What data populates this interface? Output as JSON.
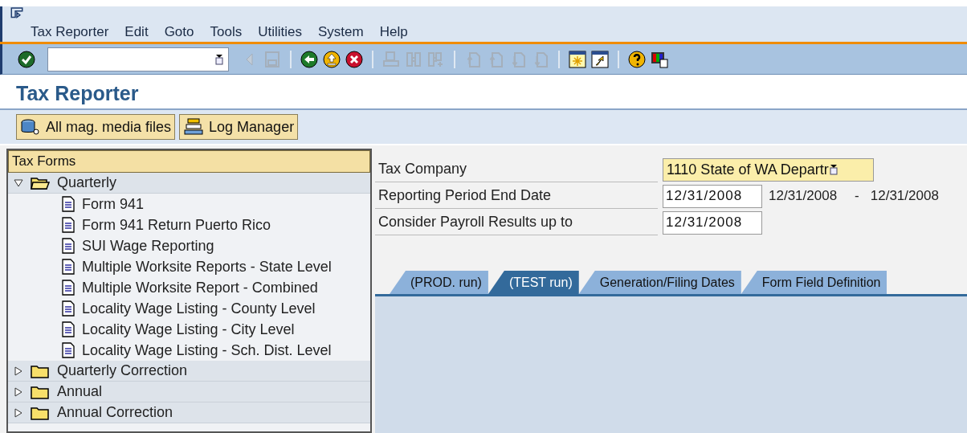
{
  "menu": [
    "Tax Reporter",
    "Edit",
    "Goto",
    "Tools",
    "Utilities",
    "System",
    "Help"
  ],
  "toolbar": [
    {
      "kind": "enter",
      "disabled": false
    },
    {
      "kind": "command-field"
    },
    {
      "kind": "back-arrow",
      "disabled": true
    },
    {
      "kind": "save",
      "disabled": true
    },
    {
      "kind": "separator"
    },
    {
      "kind": "back",
      "disabled": false
    },
    {
      "kind": "exit",
      "disabled": false
    },
    {
      "kind": "cancel",
      "disabled": false
    },
    {
      "kind": "separator"
    },
    {
      "kind": "print",
      "disabled": true
    },
    {
      "kind": "find",
      "disabled": true
    },
    {
      "kind": "find-next",
      "disabled": true
    },
    {
      "kind": "separator"
    },
    {
      "kind": "first-page",
      "disabled": true
    },
    {
      "kind": "previous-page",
      "disabled": true
    },
    {
      "kind": "next-page",
      "disabled": true
    },
    {
      "kind": "last-page",
      "disabled": true
    },
    {
      "kind": "separator"
    },
    {
      "kind": "new-session",
      "disabled": false
    },
    {
      "kind": "shortcut",
      "disabled": false
    },
    {
      "kind": "separator"
    },
    {
      "kind": "help",
      "disabled": false
    },
    {
      "kind": "layout",
      "disabled": false
    }
  ],
  "title": "Tax Reporter",
  "app_buttons": [
    {
      "kind": "database",
      "label": "All mag. media files"
    },
    {
      "kind": "stack",
      "label": "Log Manager"
    }
  ],
  "tree": {
    "header": "Tax Forms",
    "nodes": [
      {
        "kind": "folder",
        "label": "Quarterly",
        "expanded": true,
        "children": [
          {
            "kind": "document",
            "label": "Form 941"
          },
          {
            "kind": "document",
            "label": "Form 941 Return Puerto Rico"
          },
          {
            "kind": "document",
            "label": "SUI Wage Reporting"
          },
          {
            "kind": "document",
            "label": "Multiple Worksite Reports - State Level"
          },
          {
            "kind": "document",
            "label": "Multiple Worksite Report - Combined"
          },
          {
            "kind": "document",
            "label": "Locality Wage Listing - County Level"
          },
          {
            "kind": "document",
            "label": "Locality Wage Listing - City Level"
          },
          {
            "kind": "document",
            "label": "Locality Wage Listing - Sch. Dist. Level"
          }
        ]
      },
      {
        "kind": "folder",
        "label": "Quarterly Correction",
        "expanded": false
      },
      {
        "kind": "folder",
        "label": "Annual",
        "expanded": false
      },
      {
        "kind": "folder",
        "label": "Annual Correction",
        "expanded": false
      }
    ]
  },
  "form": [
    {
      "label": "Tax Company",
      "kind": "dropdown",
      "value": "1110 State of WA Departr"
    },
    {
      "label": "Reporting Period End Date",
      "kind": "date",
      "value": "12/31/2008",
      "range_from": "12/31/2008",
      "range_separator": "-",
      "range_to": "12/31/2008"
    },
    {
      "label": "Consider Payroll Results up to",
      "kind": "date",
      "value": "12/31/2008"
    }
  ],
  "tabs": [
    {
      "label": "(PROD. run)",
      "selected": false
    },
    {
      "label": "(TEST run)",
      "selected": true
    },
    {
      "label": "Generation/Filing Dates",
      "selected": false
    },
    {
      "label": "Form Field Definition",
      "selected": false
    }
  ]
}
